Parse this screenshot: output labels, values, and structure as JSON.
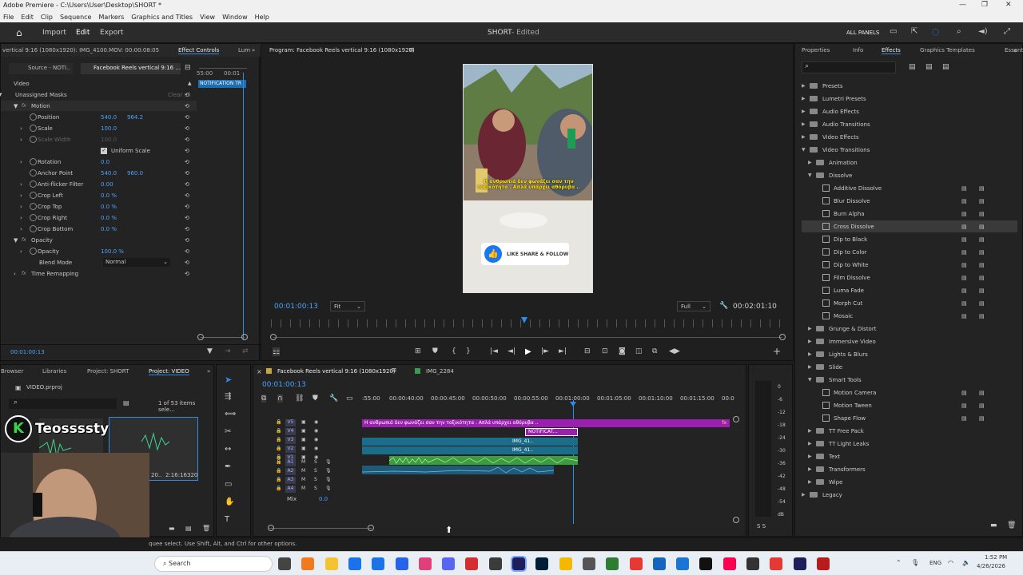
{
  "window": {
    "title": "Adobe Premiere - C:\\Users\\User\\Desktop\\SHORT *"
  },
  "menu": [
    "File",
    "Edit",
    "Clip",
    "Sequence",
    "Markers",
    "Graphics and Titles",
    "View",
    "Window",
    "Help"
  ],
  "header": {
    "tabs": [
      "Import",
      "Edit",
      "Export"
    ],
    "active": "Edit",
    "project": "SHORT",
    "status": "- Edited",
    "all_panels": "ALL PANELS"
  },
  "effect_controls": {
    "title_bar": "vertical 9:16 (1080x1920): IMG_4100.MOV: 00:00:08:05",
    "tab_effect": "Effect Controls",
    "tab_lum": "Lum",
    "source_tab": "Source - NOTI..",
    "seq_tab": "Facebook Reels vertical 9:16 ...",
    "clip_label": "NOTIFICATION TR",
    "tc1": "55:00",
    "tc2": "00:01",
    "section": "Video",
    "masks": "Unassigned Masks",
    "clear_all": "Clear all",
    "motion": "Motion",
    "position": {
      "label": "Position",
      "x": "540.0",
      "y": "964.2"
    },
    "scale": {
      "label": "Scale",
      "value": "100.0"
    },
    "scale_width": {
      "label": "Scale Width",
      "value": "100.0"
    },
    "uniform": "Uniform Scale",
    "rotation": {
      "label": "Rotation",
      "value": "0.0"
    },
    "anchor": {
      "label": "Anchor Point",
      "x": "540.0",
      "y": "960.0"
    },
    "antiflicker": {
      "label": "Anti-flicker Filter",
      "value": "0.00"
    },
    "crop_left": {
      "label": "Crop Left",
      "value": "0.0 %"
    },
    "crop_top": {
      "label": "Crop Top",
      "value": "0.0 %"
    },
    "crop_right": {
      "label": "Crop Right",
      "value": "0.0 %"
    },
    "crop_bottom": {
      "label": "Crop Bottom",
      "value": "0.0 %"
    },
    "opacity_section": "Opacity",
    "opacity": {
      "label": "Opacity",
      "value": "100.0 %"
    },
    "blend": {
      "label": "Blend Mode",
      "value": "Normal"
    },
    "time_remap": "Time Remapping",
    "timecode": "00:01:00:13"
  },
  "program": {
    "title": "Program: Facebook Reels vertical 9:16 (1080x1920)",
    "subtitle": "Η ανθρωπιά δεν φωνάζει σαν την τοξικότητα . Απλά υπάρχει αθόρυβα ..",
    "cta": "LIKE SHARE & FOLLOW",
    "timecode": "00:01:00:13",
    "fit": "Fit",
    "quality": "Full",
    "duration": "00:02:01:10"
  },
  "project": {
    "tabs": [
      "Browser",
      "Libraries",
      "Project: SHORT",
      "Project: VIDEO"
    ],
    "file": "VIDEO.prproj",
    "count": "1 of 53 items sele...",
    "thumb_label_a": "20..",
    "thumb_label_b": "2:16:16320",
    "watermark": "Teossssty"
  },
  "timeline": {
    "tabs": [
      "Facebook Reels vertical 9:16 (1080x1920)",
      "IMG_2284"
    ],
    "timecode": "00:01:00:13",
    "ruler": [
      ":55:00",
      "00:00:40:00",
      "00:00:45:00",
      "00:00:50:00",
      "00:00:55:00",
      "00:01:00:00",
      "00:01:05:00",
      "00:01:10:00",
      "00:01:15:00",
      "00:0"
    ],
    "video_tracks": [
      "V5",
      "V4",
      "V3",
      "V2",
      "V1"
    ],
    "audio_tracks": [
      "A1",
      "A2",
      "A3",
      "A4"
    ],
    "mix_label": "Mix",
    "mix_value": "0.0",
    "caption_clip": "Η ανθρωπιά δεν φωνάζει σαν την τοξικότητα . Απλά υπάρχει αθόρυβα ..",
    "notif_clip": "NOTIFICAT...",
    "img_clip": "IMG_41..",
    "fx": "fx",
    "meter_scale": [
      "0",
      "-6",
      "-12",
      "-18",
      "-24",
      "-30",
      "-36",
      "-42",
      "-48",
      "-54",
      "dB"
    ],
    "meter_sl": "S S"
  },
  "effects": {
    "tabs": [
      "Properties",
      "Info",
      "Effects",
      "Graphics Templates",
      "Essent"
    ],
    "items": [
      {
        "label": "Presets",
        "level": 0,
        "type": "folder",
        "open": false
      },
      {
        "label": "Lumetri Presets",
        "level": 0,
        "type": "folder",
        "open": false
      },
      {
        "label": "Audio Effects",
        "level": 0,
        "type": "folder",
        "open": false
      },
      {
        "label": "Audio Transitions",
        "level": 0,
        "type": "folder",
        "open": false
      },
      {
        "label": "Video Effects",
        "level": 0,
        "type": "folder",
        "open": false
      },
      {
        "label": "Video Transitions",
        "level": 0,
        "type": "folder",
        "open": true
      },
      {
        "label": "Animation",
        "level": 1,
        "type": "folder",
        "open": false
      },
      {
        "label": "Dissolve",
        "level": 1,
        "type": "folder",
        "open": true
      },
      {
        "label": "Additive Dissolve",
        "level": 2,
        "type": "fx"
      },
      {
        "label": "Blur Dissolve",
        "level": 2,
        "type": "fx"
      },
      {
        "label": "Burn Alpha",
        "level": 2,
        "type": "fx"
      },
      {
        "label": "Cross Dissolve",
        "level": 2,
        "type": "fx",
        "selected": true
      },
      {
        "label": "Dip to Black",
        "level": 2,
        "type": "fx"
      },
      {
        "label": "Dip to Color",
        "level": 2,
        "type": "fx"
      },
      {
        "label": "Dip to White",
        "level": 2,
        "type": "fx"
      },
      {
        "label": "Film Dissolve",
        "level": 2,
        "type": "fx"
      },
      {
        "label": "Luma Fade",
        "level": 2,
        "type": "fx"
      },
      {
        "label": "Morph Cut",
        "level": 2,
        "type": "fx"
      },
      {
        "label": "Mosaic",
        "level": 2,
        "type": "fx"
      },
      {
        "label": "Grunge & Distort",
        "level": 1,
        "type": "folder",
        "open": false
      },
      {
        "label": "Immersive Video",
        "level": 1,
        "type": "folder",
        "open": false
      },
      {
        "label": "Lights & Blurs",
        "level": 1,
        "type": "folder",
        "open": false
      },
      {
        "label": "Slide",
        "level": 1,
        "type": "folder",
        "open": false
      },
      {
        "label": "Smart Tools",
        "level": 1,
        "type": "folder",
        "open": true
      },
      {
        "label": "Motion Camera",
        "level": 2,
        "type": "fx"
      },
      {
        "label": "Motion Tween",
        "level": 2,
        "type": "fx"
      },
      {
        "label": "Shape Flow",
        "level": 2,
        "type": "fx"
      },
      {
        "label": "TT Free Pack",
        "level": 1,
        "type": "folder",
        "open": false
      },
      {
        "label": "TT Light Leaks",
        "level": 1,
        "type": "folder",
        "open": false
      },
      {
        "label": "Text",
        "level": 1,
        "type": "folder",
        "open": false
      },
      {
        "label": "Transformers",
        "level": 1,
        "type": "folder",
        "open": false
      },
      {
        "label": "Wipe",
        "level": 1,
        "type": "folder",
        "open": false
      },
      {
        "label": "Legacy",
        "level": 0,
        "type": "folder",
        "open": false
      }
    ]
  },
  "status": {
    "hint": "quee select. Use Shift, Alt, and Ctrl for other options."
  },
  "taskbar": {
    "search": "Search",
    "lang": "ENG",
    "time": "1:52 PM",
    "date": "4/26/2026"
  },
  "colors": {
    "accent": "#2d8ceb",
    "caption": "#9b1fb0",
    "video_clip": "#1b6d8a",
    "audio_clip": "#3d9c3f"
  }
}
